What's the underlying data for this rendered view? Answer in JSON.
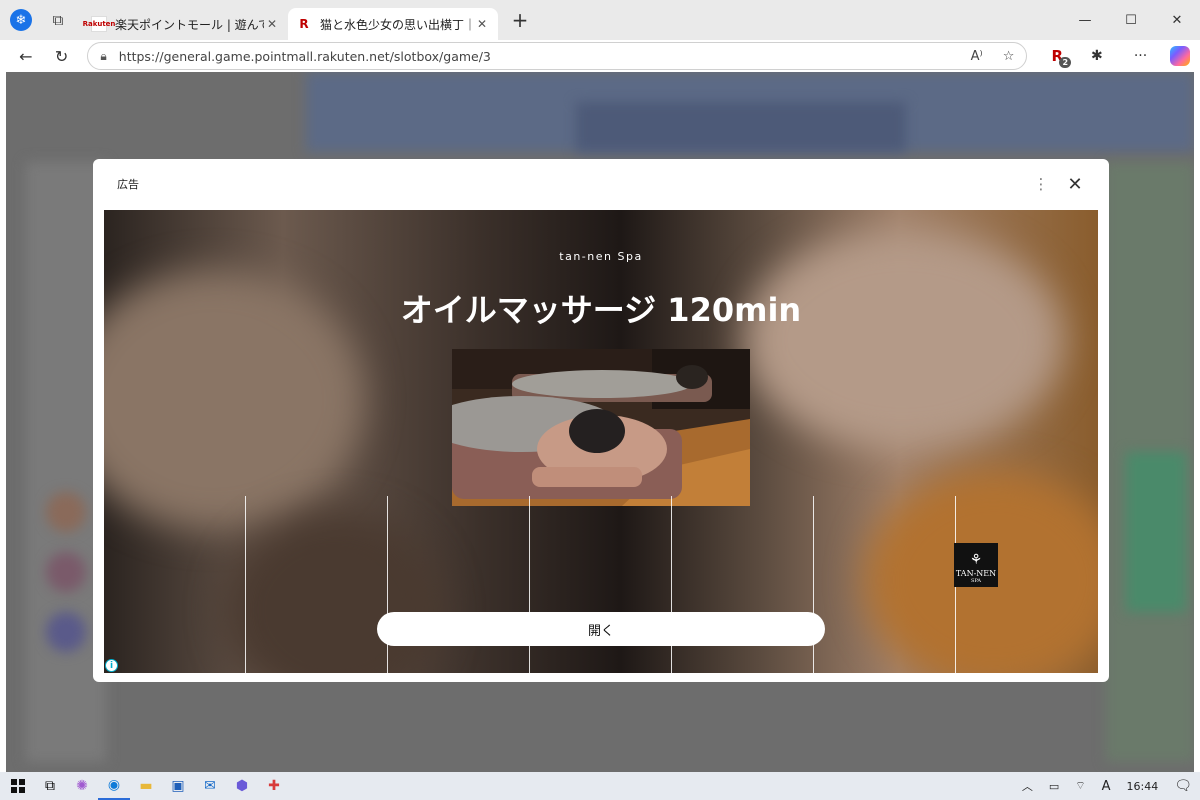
{
  "browser": {
    "tabs": [
      {
        "favicon_text": "Rakuten",
        "title": "楽天ポイントモール | 遊んで、買って楽",
        "active": false
      },
      {
        "favicon_text": "R",
        "title": "猫と水色少女の思い出横丁｜スロッ",
        "active": true
      }
    ],
    "url": "https://general.game.pointmall.rakuten.net/slotbox/game/3",
    "extension_badge": "2"
  },
  "modal": {
    "label": "広告",
    "more_icon": "⋮",
    "close_icon": "✕"
  },
  "ad": {
    "brand": "tan-nen Spa",
    "headline": "オイルマッサージ 120min",
    "cta_label": "開く",
    "logo_text": "TAN-NEN",
    "logo_sub": "SPA",
    "info_icon": "i"
  },
  "taskbar": {
    "time": "16:44",
    "ime": "A"
  }
}
